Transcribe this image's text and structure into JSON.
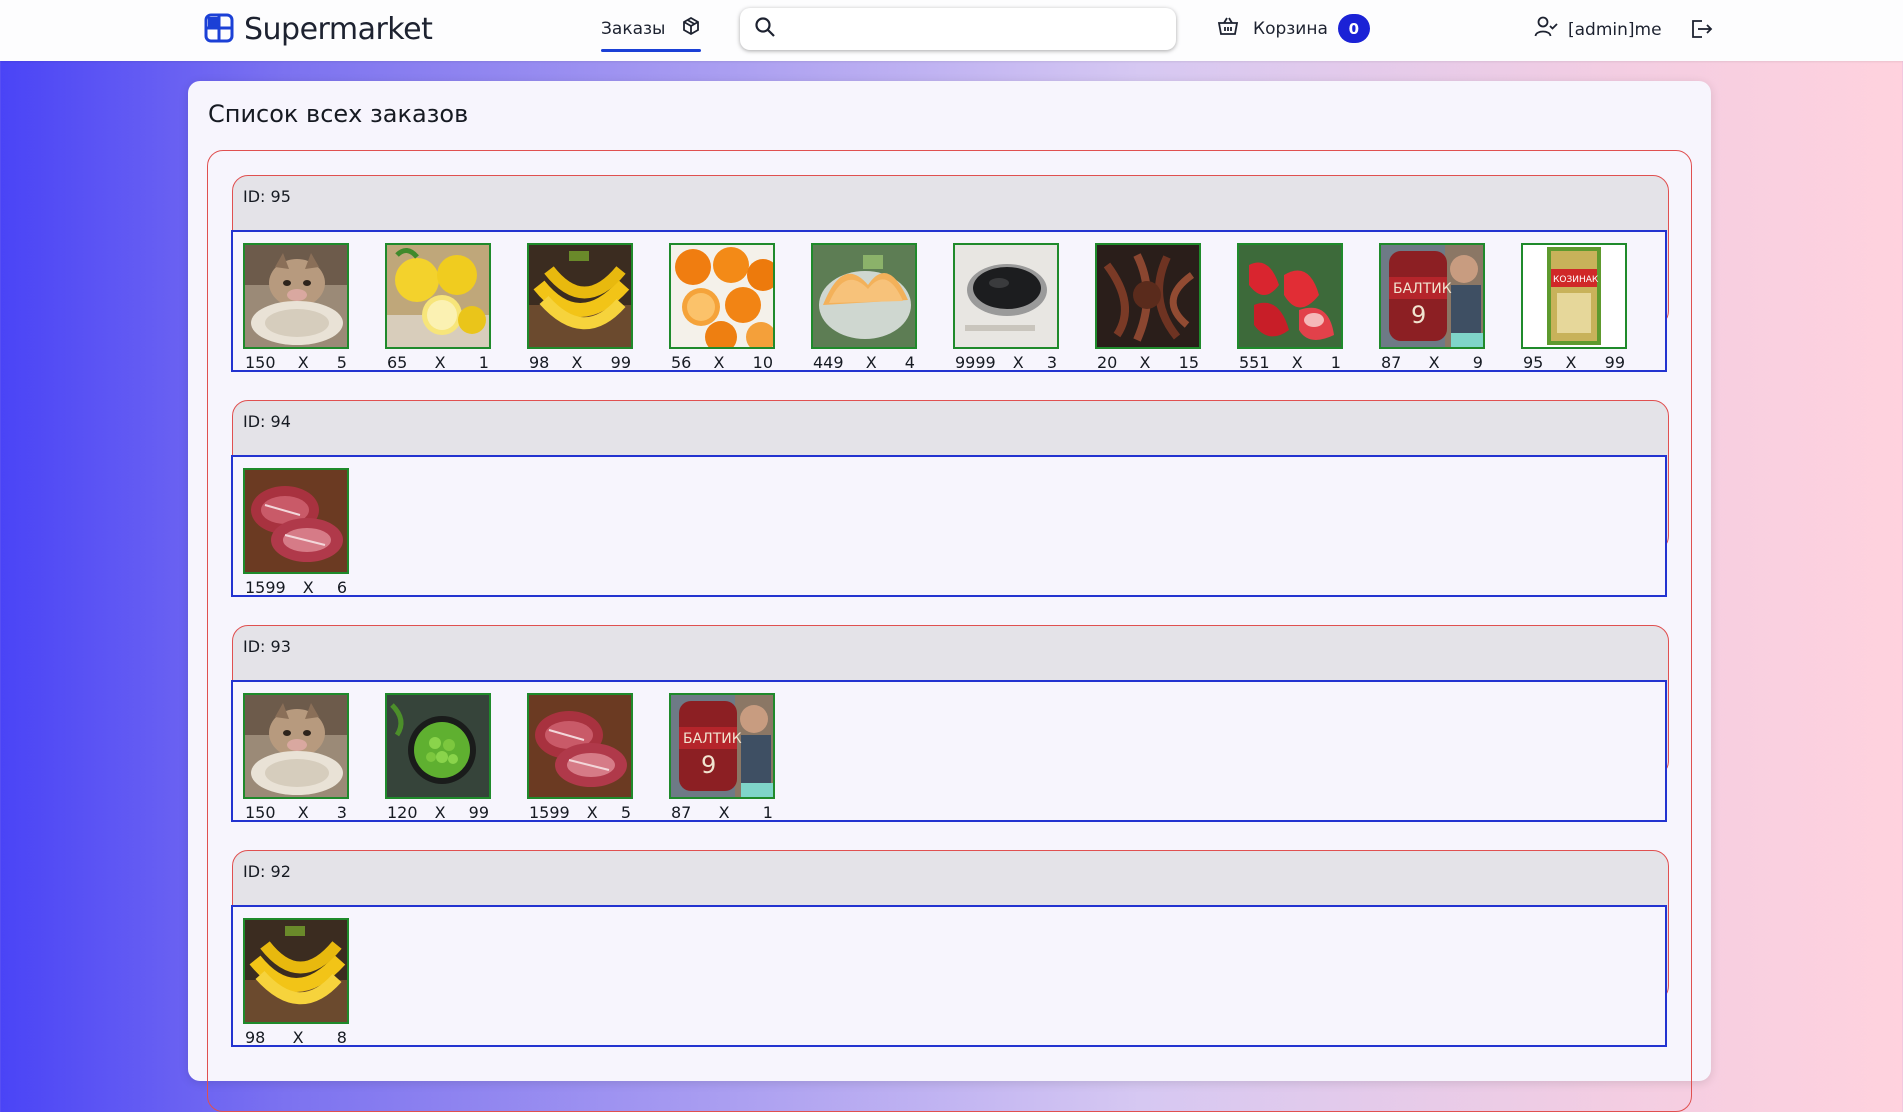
{
  "navbar": {
    "brand": "Supermarket",
    "orders_label": "Заказы",
    "search_placeholder": "",
    "cart_label": "Корзина",
    "cart_count": "0",
    "username": "[admin]me"
  },
  "page": {
    "title": "Список всех заказов"
  },
  "orders": [
    {
      "id_label": "ID: 95",
      "items": [
        {
          "image": "cat-plate",
          "price": "150",
          "x": "X",
          "qty": "5"
        },
        {
          "image": "lemons",
          "price": "65",
          "x": "X",
          "qty": "1"
        },
        {
          "image": "bananas",
          "price": "98",
          "x": "X",
          "qty": "99"
        },
        {
          "image": "oranges",
          "price": "56",
          "x": "X",
          "qty": "10"
        },
        {
          "image": "melon",
          "price": "449",
          "x": "X",
          "qty": "4"
        },
        {
          "image": "caviar",
          "price": "9999",
          "x": "X",
          "qty": "3"
        },
        {
          "image": "octopus",
          "price": "20",
          "x": "X",
          "qty": "15"
        },
        {
          "image": "strawberries",
          "price": "551",
          "x": "X",
          "qty": "1"
        },
        {
          "image": "beer-baltika",
          "price": "87",
          "x": "X",
          "qty": "9"
        },
        {
          "image": "kozinak",
          "price": "95",
          "x": "X",
          "qty": "99"
        }
      ]
    },
    {
      "id_label": "ID: 94",
      "items": [
        {
          "image": "steak",
          "price": "1599",
          "x": "X",
          "qty": "6"
        }
      ]
    },
    {
      "id_label": "ID: 93",
      "items": [
        {
          "image": "cat-plate",
          "price": "150",
          "x": "X",
          "qty": "3"
        },
        {
          "image": "peas",
          "price": "120",
          "x": "X",
          "qty": "99"
        },
        {
          "image": "steak",
          "price": "1599",
          "x": "X",
          "qty": "5"
        },
        {
          "image": "beer-baltika",
          "price": "87",
          "x": "X",
          "qty": "1"
        }
      ]
    },
    {
      "id_label": "ID: 92",
      "items": [
        {
          "image": "bananas",
          "price": "98",
          "x": "X",
          "qty": "8"
        }
      ]
    }
  ],
  "colors": {
    "accent": "#1b22d6",
    "order_border": "#e05050",
    "items_border": "#2333d0",
    "thumb_border": "#1f8a2b"
  }
}
